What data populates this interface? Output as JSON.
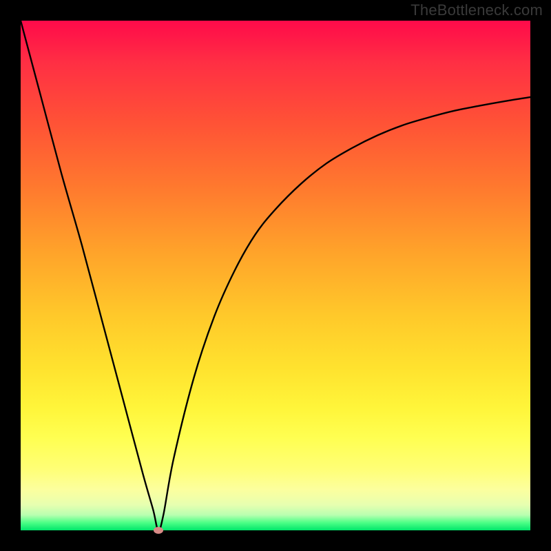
{
  "watermark": "TheBottleneck.com",
  "colors": {
    "frame_bg": "#000000",
    "curve": "#000000",
    "marker": "#d88a86",
    "gradient_top": "#ff0a4a",
    "gradient_bottom": "#00e66a"
  },
  "chart_data": {
    "type": "line",
    "title": "",
    "xlabel": "",
    "ylabel": "",
    "xlim": [
      0,
      100
    ],
    "ylim": [
      0,
      100
    ],
    "grid": false,
    "legend": false,
    "series": [
      {
        "name": "bottleneck-curve",
        "x": [
          0,
          4,
          8,
          12,
          16,
          20,
          24,
          26,
          27,
          28,
          30,
          34,
          38,
          42,
          46,
          50,
          55,
          60,
          65,
          70,
          75,
          80,
          85,
          90,
          95,
          100
        ],
        "y": [
          100,
          85,
          70,
          56,
          41,
          26,
          11,
          4,
          0,
          3,
          14,
          30,
          42,
          51,
          58,
          63,
          68,
          72,
          75,
          77.5,
          79.5,
          81,
          82.3,
          83.3,
          84.2,
          85
        ]
      }
    ],
    "annotations": [
      {
        "name": "optimal-marker",
        "x": 27,
        "y": 0
      }
    ]
  }
}
